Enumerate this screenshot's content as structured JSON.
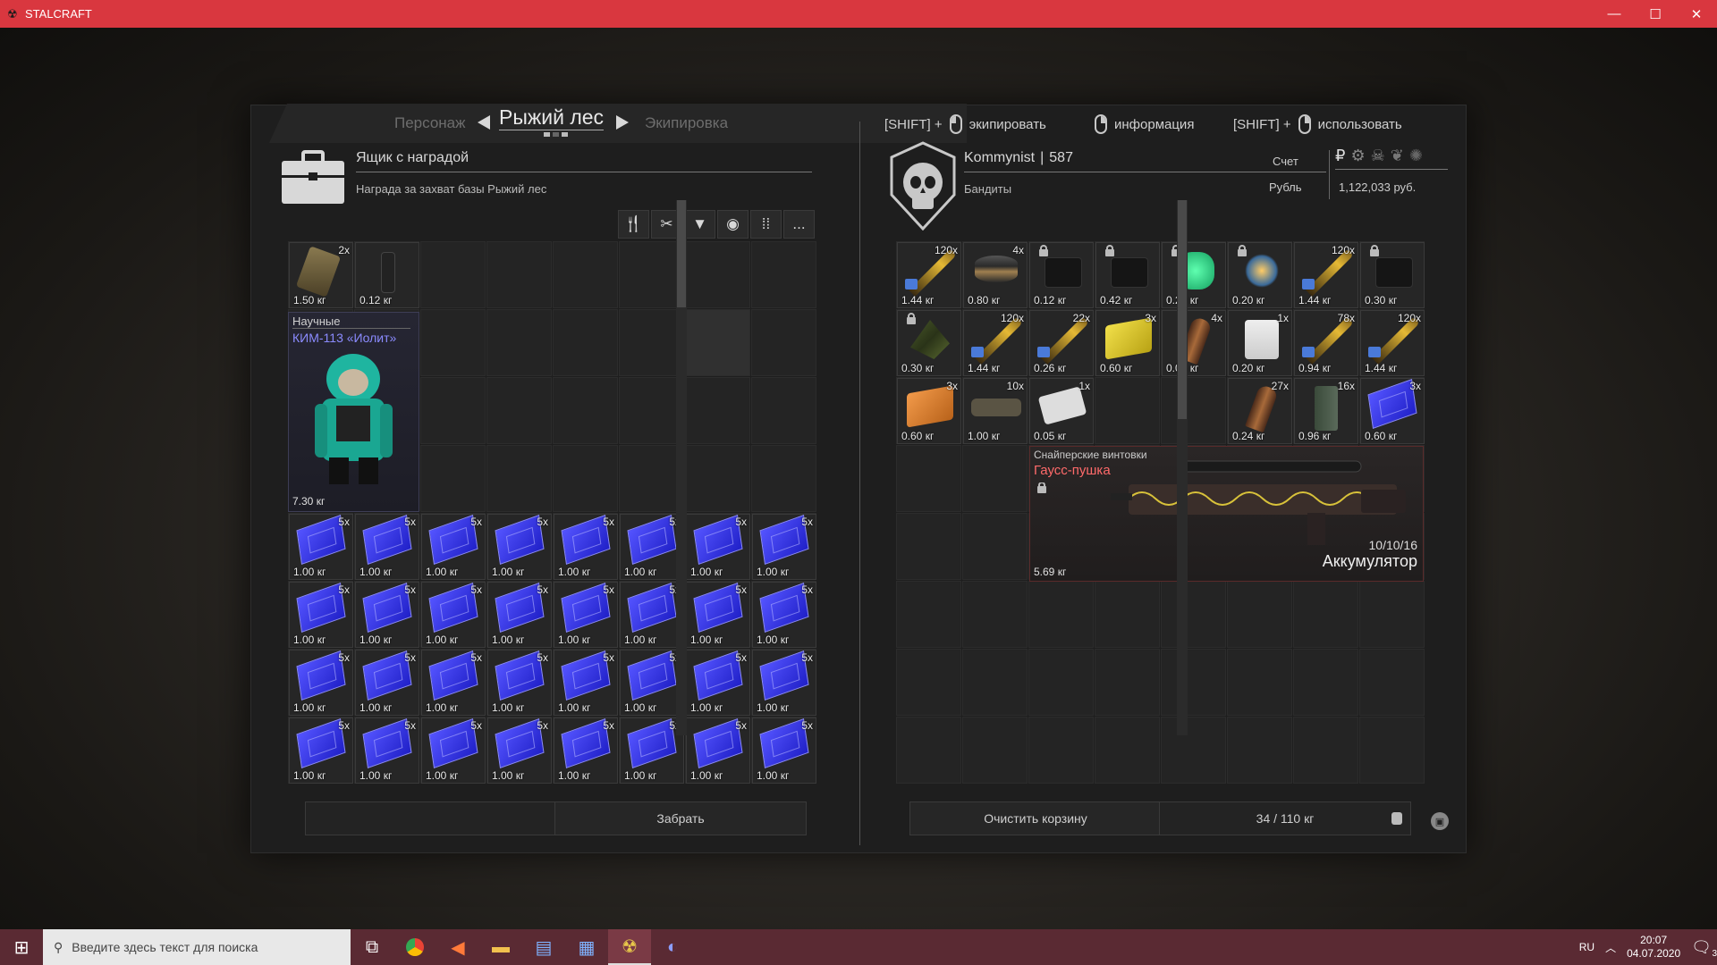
{
  "window": {
    "title": "STALCRAFT",
    "icon": "radiation-icon",
    "controls": [
      "—",
      "☐",
      "✕"
    ]
  },
  "nav": {
    "left_tab": "Персонаж",
    "active_tab": "Рыжий лес",
    "right_tab": "Экипировка"
  },
  "hints": {
    "shift1": "[SHIFT] +",
    "equip": "экипировать",
    "info": "информация",
    "shift2": "[SHIFT] +",
    "use": "использовать"
  },
  "left": {
    "title": "Ящик с наградой",
    "subtitle": "Награда за захват базы Рыжий лес",
    "filters": [
      "fork-knife-icon",
      "tools-icon",
      "vest-icon",
      "camera-icon",
      "ammo-icon",
      "..."
    ],
    "item1": {
      "count": "2x",
      "weight": "1.50 кг"
    },
    "item2": {
      "weight": "0.12 кг"
    },
    "suit": {
      "category": "Научные",
      "name": "КИМ-113 «Иолит»",
      "weight": "7.30 кг"
    },
    "book": {
      "count": "5x",
      "weight": "1.00 кг"
    },
    "take_button": "Забрать"
  },
  "right": {
    "player": "Kommynist",
    "sep": "|",
    "level": "587",
    "faction": "Бандиты",
    "account_label": "Счет",
    "currency_label": "Рубль",
    "balance": "1,122,033 руб.",
    "currency_icons": [
      "₽",
      "gear-icon",
      "skull-icon",
      "wings-icon",
      "star-icon"
    ],
    "items_row1": [
      {
        "count": "120x",
        "weight": "1.44 кг",
        "kind": "bullet"
      },
      {
        "count": "4x",
        "weight": "0.80 кг",
        "kind": "can"
      },
      {
        "count": "",
        "weight": "0.12 кг",
        "kind": "dark",
        "lock": true
      },
      {
        "count": "",
        "weight": "0.42 кг",
        "kind": "dark",
        "lock": true
      },
      {
        "count": "",
        "weight": "0.20 кг",
        "kind": "green",
        "lock": true
      },
      {
        "count": "",
        "weight": "0.20 кг",
        "kind": "artifact",
        "lock": true
      },
      {
        "count": "120x",
        "weight": "1.44 кг",
        "kind": "bullet"
      },
      {
        "count": "",
        "weight": "0.30 кг",
        "kind": "dark",
        "lock": true
      }
    ],
    "items_row2": [
      {
        "count": "",
        "weight": "0.30 кг",
        "kind": "camo",
        "lock": true
      },
      {
        "count": "120x",
        "weight": "1.44 кг",
        "kind": "bullet"
      },
      {
        "count": "22x",
        "weight": "0.26 кг",
        "kind": "bullet"
      },
      {
        "count": "3x",
        "weight": "0.60 кг",
        "kind": "yellow-book"
      },
      {
        "count": "4x",
        "weight": "0.04 кг",
        "kind": "shell"
      },
      {
        "count": "1x",
        "weight": "0.20 кг",
        "kind": "jar"
      },
      {
        "count": "78x",
        "weight": "0.94 кг",
        "kind": "bullet"
      },
      {
        "count": "120x",
        "weight": "1.44 кг",
        "kind": "bullet"
      }
    ],
    "items_row3": [
      {
        "count": "3x",
        "weight": "0.60 кг",
        "kind": "orange-book"
      },
      {
        "count": "10x",
        "weight": "1.00 кг",
        "kind": "brick"
      },
      {
        "count": "1x",
        "weight": "0.05 кг",
        "kind": "pills"
      },
      {
        "count": "27x",
        "weight": "0.24 кг",
        "kind": "shell"
      },
      {
        "count": "16x",
        "weight": "0.96 кг",
        "kind": "canister"
      },
      {
        "count": "3x",
        "weight": "0.60 кг",
        "kind": "book"
      }
    ],
    "rifle": {
      "category": "Снайперские винтовки",
      "name": "Гаусс-пушка",
      "ammo": "10/10/16",
      "ammo_type": "Аккумулятор",
      "weight": "5.69 кг"
    },
    "clear_button": "Очистить корзину",
    "capacity": "34 / 110 кг"
  },
  "taskbar": {
    "search_placeholder": "Введите здесь текст для поиска",
    "lang": "RU",
    "time": "20:07",
    "date": "04.07.2020",
    "notif_count": "3"
  }
}
